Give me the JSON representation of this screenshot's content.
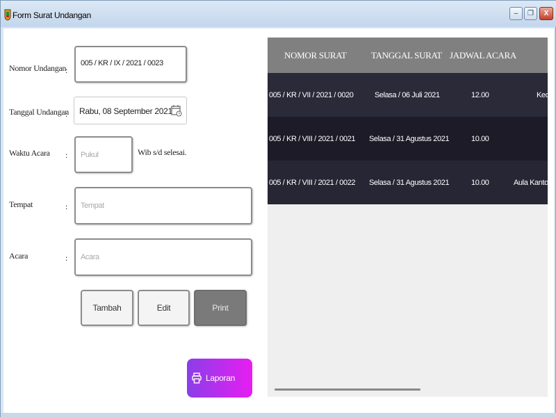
{
  "window": {
    "title": "Form Surat Undangan",
    "controls": {
      "minimize": "–",
      "restore": "❐",
      "close": "X"
    }
  },
  "form": {
    "nomor": {
      "label": "Nomor Undangan",
      "colon": ":",
      "value": "005 / KR / IX / 2021 / 0023"
    },
    "tanggal": {
      "label": "Tanggal Undangan",
      "colon": ":",
      "value": "Rabu, 08 September 2021"
    },
    "waktu": {
      "label": "Waktu Acara",
      "colon": ":",
      "placeholder": "Pukul",
      "suffix": "Wib s/d selesai."
    },
    "tempat": {
      "label": "Tempat",
      "colon": ":",
      "placeholder": "Tempat"
    },
    "acara": {
      "label": "Acara",
      "colon": ":",
      "placeholder": "Acara"
    }
  },
  "buttons": {
    "tambah": "Tambah",
    "edit": "Edit",
    "print": "Print",
    "laporan": "Laporan"
  },
  "grid": {
    "columns": [
      "NOMOR SURAT",
      "TANGGAL SURAT",
      "JADWAL ACARA"
    ],
    "rows": [
      {
        "nomor": "005 / KR / VII / 2021 / 0020",
        "tanggal": "Selasa  /  06 Juli 2021",
        "jadwal": "12.00",
        "tempat": "Keca"
      },
      {
        "nomor": "005 / KR / VIII / 2021 / 0021",
        "tanggal": "Selasa  /  31 Agustus 2021",
        "jadwal": "10.00",
        "tempat": ""
      },
      {
        "nomor": "005 / KR / VIII / 2021 / 0022",
        "tanggal": "Selasa  /  31 Agustus 2021",
        "jadwal": "10.00",
        "tempat": "Aula Kantor C"
      }
    ]
  },
  "colors": {
    "header_bg": "#808080",
    "row_colors": [
      "#2b2a39",
      "#1c1b27",
      "#272634"
    ],
    "laporan_gradient": [
      "#8a3fe8",
      "#e81df2"
    ]
  }
}
